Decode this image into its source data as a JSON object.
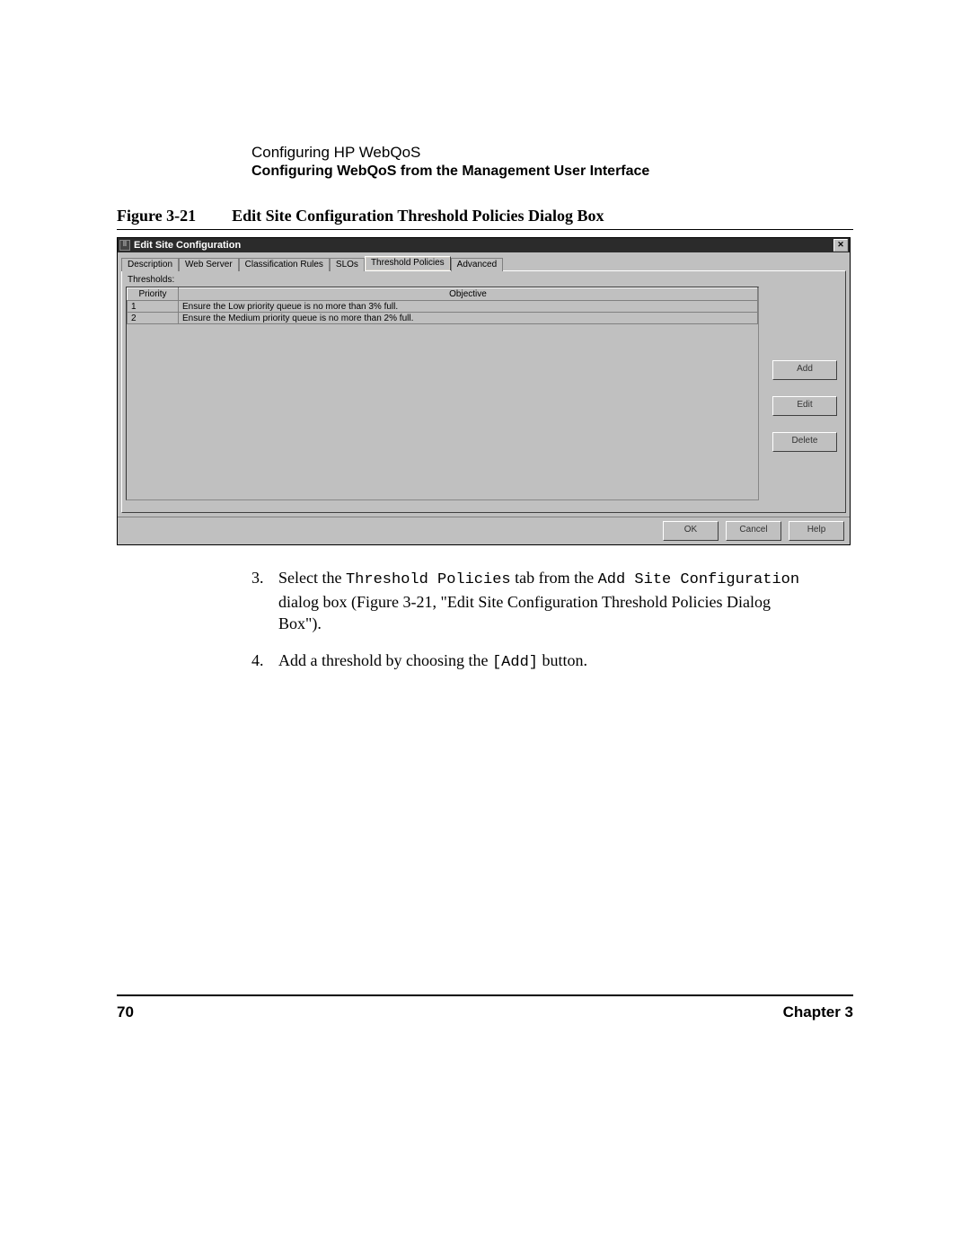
{
  "header": {
    "line1": "Configuring HP WebQoS",
    "line2": "Configuring WebQoS from the Management User Interface"
  },
  "figure": {
    "label": "Figure 3-21",
    "title": "Edit Site Configuration Threshold Policies Dialog Box"
  },
  "dialog": {
    "title": "Edit Site Configuration",
    "tabs": [
      "Description",
      "Web Server",
      "Classification Rules",
      "SLOs",
      "Threshold Policies",
      "Advanced"
    ],
    "active_tab_index": 4,
    "panel_label": "Thresholds:",
    "columns": {
      "priority": "Priority",
      "objective": "Objective"
    },
    "rows": [
      {
        "priority": "1",
        "objective": "Ensure the Low priority queue is no more than 3% full."
      },
      {
        "priority": "2",
        "objective": "Ensure the Medium priority queue is no more than 2% full."
      }
    ],
    "side_buttons": {
      "add": "Add",
      "edit": "Edit",
      "delete": "Delete"
    },
    "bottom_buttons": {
      "ok": "OK",
      "cancel": "Cancel",
      "help": "Help"
    }
  },
  "body": {
    "item3": {
      "num": "3.",
      "pre": "Select the ",
      "mono1": "Threshold Policies",
      "mid": " tab from the ",
      "mono2": "Add Site Configuration",
      "post": " dialog box (Figure 3-21, \"Edit Site Configuration Threshold Policies Dialog Box\")."
    },
    "item4": {
      "num": "4.",
      "pre": "Add a threshold by choosing the ",
      "mono": "[Add]",
      "post": " button."
    }
  },
  "footer": {
    "page": "70",
    "chapter": "Chapter 3"
  }
}
